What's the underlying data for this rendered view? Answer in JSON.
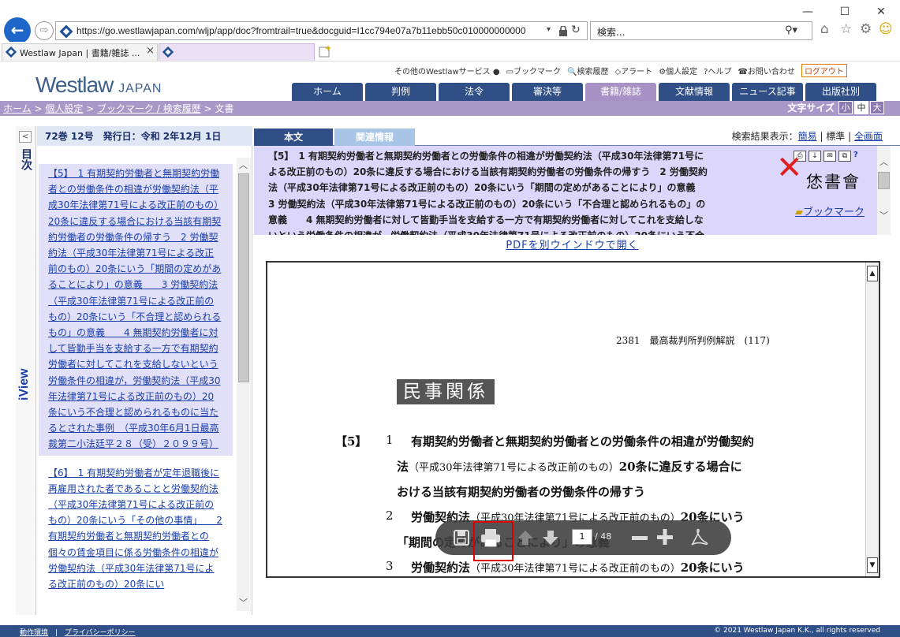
{
  "browser": {
    "url": "https://go.westlawjapan.com/wljp/app/doc?fromtrail=true&docguid=I1cc794e07a7b11ebb50c010000000000",
    "search_placeholder": "検索...",
    "tab1_title": "Westlaw Japan | 書籍/雑誌 ...",
    "tab_close": "×",
    "back_icon": "←",
    "forward_icon": "⇨",
    "minimize": "—",
    "maximize": "☐",
    "close": "✕"
  },
  "header": {
    "logo_main": "Westlaw",
    "logo_sub": "JAPAN",
    "top_links": [
      "その他のWestlawサービス",
      "ブックマーク",
      "検索履歴",
      "アラート",
      "個人設定",
      "ヘルプ",
      "お問い合わせ"
    ],
    "logout": "ログアウト",
    "nav_tabs": [
      "ホーム",
      "判例",
      "法令",
      "審決等",
      "書籍/雑誌",
      "文献情報",
      "ニュース記事",
      "出版社別"
    ],
    "active_tab_index": 4
  },
  "breadcrumb": {
    "items": [
      "ホーム",
      "個人設定",
      "ブックマーク / 検索履歴"
    ],
    "separator": " > ",
    "current": "文書"
  },
  "font_size": {
    "label": "文字サイズ",
    "options": [
      "小",
      "中",
      "大"
    ],
    "selected": "中"
  },
  "left_panel": {
    "side_label_top": "目次",
    "side_label_bottom": "iView",
    "collapse_icon": "<",
    "issue_header": "72巻 12号　発行日：令和 2年12月 1日",
    "items": [
      "【5】　1 有期契約労働者と無期契約労働者との労働条件の相違が労働契約法（平成30年法律第71号による改正前のもの）20条に違反する場合における当該有期契約労働者の労働条件の帰すう　2 労働契約法（平成30年法律第71号による改正前のもの）20条にいう「期間の定めがあることにより」の意義　　3 労働契約法（平成30年法律第71号による改正前のもの）20条にいう「不合理と認められるもの」の意義　　4 無期契約労働者に対して皆勤手当を支給する一方で有期契約労働者に対してこれを支給しないという労働条件の相違が，労働契約法（平成30年法律第71号による改正前のもの）20条にいう不合理と認められるものに当たるとされた事例　（平成30年6月1日最高裁第二小法廷平２８（受）２０９９号）",
      "【6】　1 有期契約労働者が定年退職後に再雇用された者であることと労働契約法（平成30年法律第71号による改正前のもの）20条にいう「その他の事情」　　2 有期契約労働者と無期契約労働者との個々の賃金項目に係る労働条件の相違が労働契約法（平成30年法律第71号による改正前のもの）20条にい"
    ],
    "selected_index": 0
  },
  "right_panel": {
    "tab_main": "本文",
    "tab_related": "関連情報",
    "search_result_label": "検索結果表示：",
    "search_modes": [
      "簡易",
      "標準",
      "全画面"
    ],
    "doc_title": "【5】　1 有期契約労働者と無期契約労働者との労働条件の相違が労働契約法（平成30年法律第71号による改正前のもの）20条に違反する場合における当該有期契約労働者の労働条件の帰すう　2 労働契約法（平成30年法律第71号による改正前のもの）20条にいう「期間の定めがあることにより」の意義　　3 労働契約法（平成30年法律第71号による改正前のもの）20条にいう「不合理と認められるもの」の意義　　4 無期契約労働者に対して皆勤手当を支給する一方で有期契約労働者に対してこれを支給しないという労働条件の相違が，労働契約法（平成30年法律第71号による改正前のもの）20条にいう不合理と認められるものに当たるとされた事例",
    "stamp_text": "恷書會",
    "bookmark_label": "ブックマーク",
    "pdf_link": "PDFを別ウインドウで開く"
  },
  "pdf": {
    "page_header": "2381　最高裁判所判例解説　(117)",
    "section_heading": "民事関係",
    "item_number": "【5】",
    "lines": [
      {
        "num": "1",
        "text": "有期契約労働者と無期契約労働者との労働条件の相違が労働契約"
      },
      {
        "num": "",
        "pre": "法",
        "small": "（平成30年法律第71号による改正前のもの）",
        "post": "20条に違反する場合に"
      },
      {
        "num": "",
        "text": "おける当該有期契約労働者の労働条件の帰すう"
      },
      {
        "num": "2",
        "pre": "労働契約法",
        "small": "（平成30年法律第71号による改正前のもの）",
        "post": "20条にいう"
      },
      {
        "num": "",
        "text": "「期間の定めがあることにより」の意義"
      },
      {
        "num": "3",
        "pre": "労働契約法",
        "small": "（平成30年法律第71号による改正前のもの）",
        "post": "20条にいう"
      }
    ],
    "current_page": "1",
    "total_pages": "/ 48"
  },
  "footer": {
    "links": [
      "動作環境",
      "プライバシーポリシー"
    ],
    "separator": "|",
    "copyright": "© 2021 Westlaw Japan K.K., all rights reserved"
  }
}
